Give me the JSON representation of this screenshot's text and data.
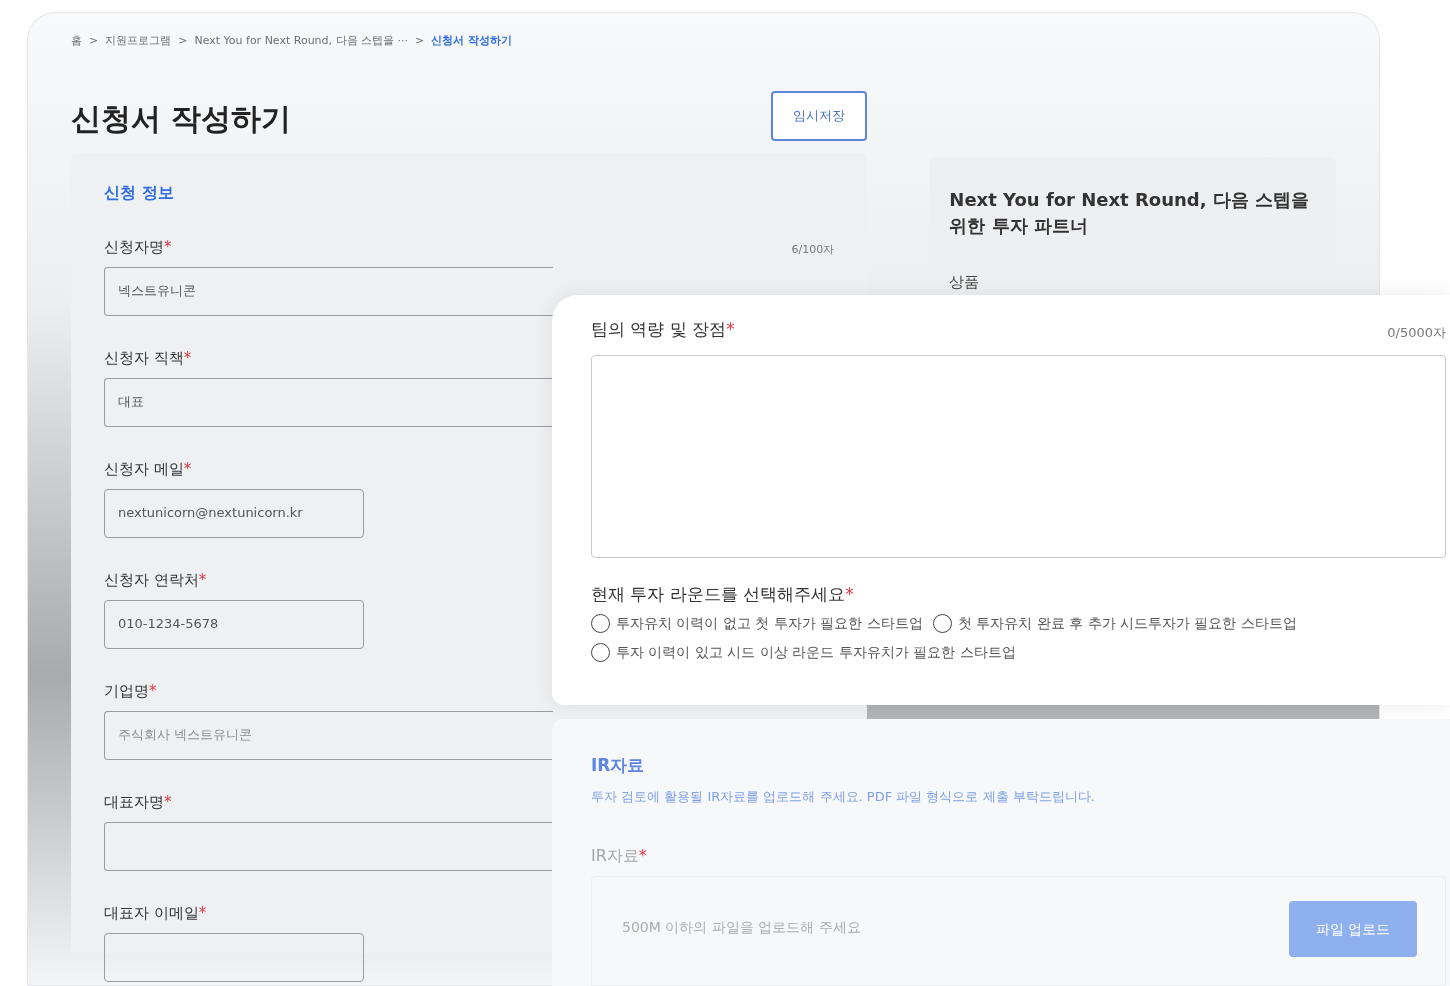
{
  "breadcrumb": [
    {
      "label": "홈",
      "current": false
    },
    {
      "label": "지원프로그램",
      "current": false
    },
    {
      "label": "Next You for Next Round, 다음 스텝을 ···",
      "current": false
    },
    {
      "label": "신청서 작성하기",
      "current": true
    }
  ],
  "breadcrumb_separator": ">",
  "required_mark": "*",
  "page_title": "신청서 작성하기",
  "save_button": "임시저장",
  "section_title": "신청 정보",
  "fields": [
    {
      "label": "신청자명",
      "required": true,
      "value": "넥스트유니콘",
      "counter": "6/100자",
      "wide": true
    },
    {
      "label": "신청자 직책",
      "required": true,
      "value": "대표",
      "wide": true
    },
    {
      "label": "신청자 메일",
      "required": true,
      "value": "nextunicorn@nextunicorn.kr",
      "wide": false
    },
    {
      "label": "신청자 연락처",
      "required": true,
      "value": "010-1234-5678",
      "wide": false
    },
    {
      "label": "기업명",
      "required": true,
      "placeholder": "주식회사 넥스트유니콘",
      "wide": true
    },
    {
      "label": "대표자명",
      "required": true,
      "wide": true
    },
    {
      "label": "대표자 이메일",
      "required": true,
      "wide": false
    }
  ],
  "side_card": {
    "title": "Next You for Next Round, 다음 스텝을 위한 투자 파트너",
    "product_label": "상품"
  },
  "team_field": {
    "label": "팀의 역량 및 장점",
    "required": true,
    "counter": "0/5000자"
  },
  "round_question": {
    "label": "현재 투자 라운드를 선택해주세요",
    "required": true,
    "options": [
      {
        "label": "투자유치 이력이 없고 첫 투자가 필요한 스타트업",
        "selected": false
      },
      {
        "label": "첫 투자유치 완료 후 추가 시드투자가 필요한 스타트업",
        "selected": false
      },
      {
        "label": "투자 이력이 있고 시드 이상 라운드 투자유치가 필요한 스타트업",
        "selected": false
      }
    ]
  },
  "ir_section": {
    "title": "IR자료",
    "description": "투자 검토에 활용될 IR자료를 업로드해 주세요. PDF 파일 형식으로 제출 부탁드립니다.",
    "field_label": "IR자료",
    "required": true,
    "placeholder": "500M 이하의 파일을 업로드해 주세요",
    "upload_button": "파일 업로드"
  }
}
